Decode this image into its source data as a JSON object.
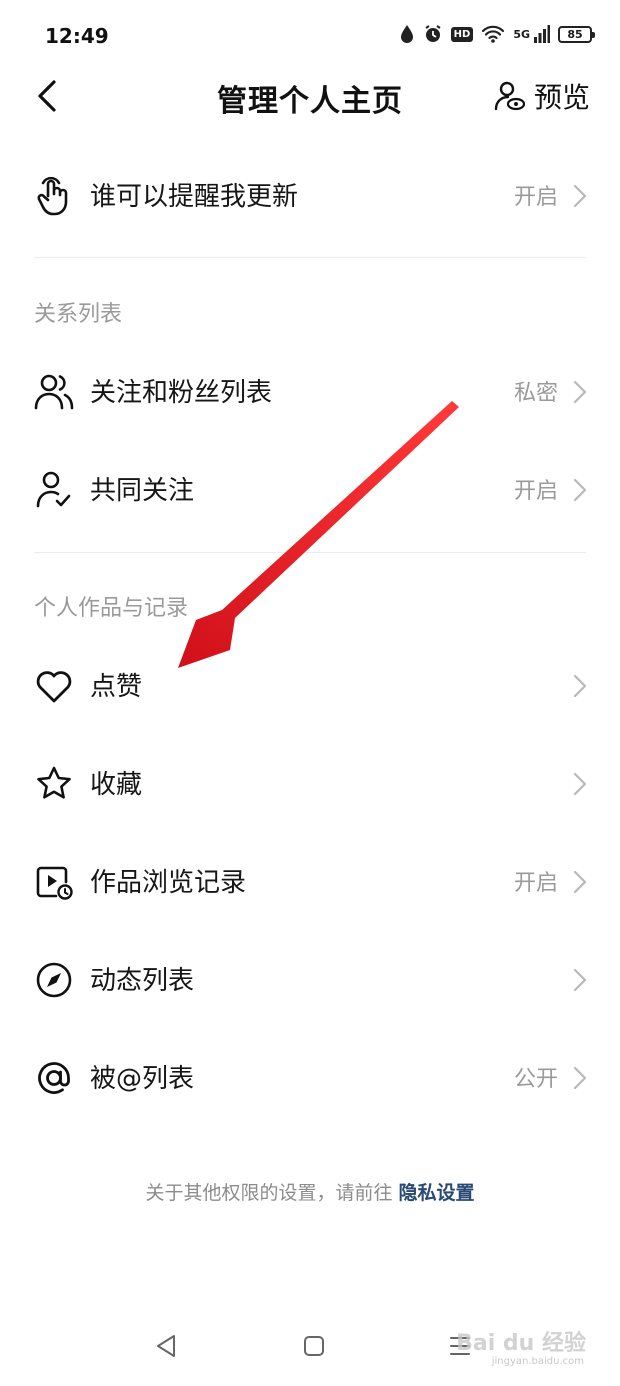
{
  "status_bar": {
    "time": "12:49",
    "network": "5G",
    "hd_badge": "HD",
    "battery": "85"
  },
  "header": {
    "title": "管理个人主页",
    "preview_label": "预览"
  },
  "rows": [
    {
      "label": "谁可以提醒我更新",
      "value": "开启",
      "icon": "finger-tap-icon"
    },
    {
      "label": "关注和粉丝列表",
      "value": "私密",
      "icon": "users-icon"
    },
    {
      "label": "共同关注",
      "value": "开启",
      "icon": "user-check-icon"
    },
    {
      "label": "点赞",
      "value": "",
      "icon": "heart-icon"
    },
    {
      "label": "收藏",
      "value": "",
      "icon": "star-icon"
    },
    {
      "label": "作品浏览记录",
      "value": "开启",
      "icon": "video-history-icon"
    },
    {
      "label": "动态列表",
      "value": "",
      "icon": "compass-icon"
    },
    {
      "label": "被@列表",
      "value": "公开",
      "icon": "at-icon"
    }
  ],
  "sections": {
    "relations": "关系列表",
    "works": "个人作品与记录"
  },
  "footer": {
    "note": "关于其他权限的设置，请前往 ",
    "link": "隐私设置"
  },
  "watermark": {
    "brand": "Bai du 经验",
    "url": "jingyan.baidu.com"
  },
  "colors": {
    "link": "#2a4a73",
    "secondary_text": "#9a9a9a",
    "annotation_arrow": "#e8121c"
  }
}
